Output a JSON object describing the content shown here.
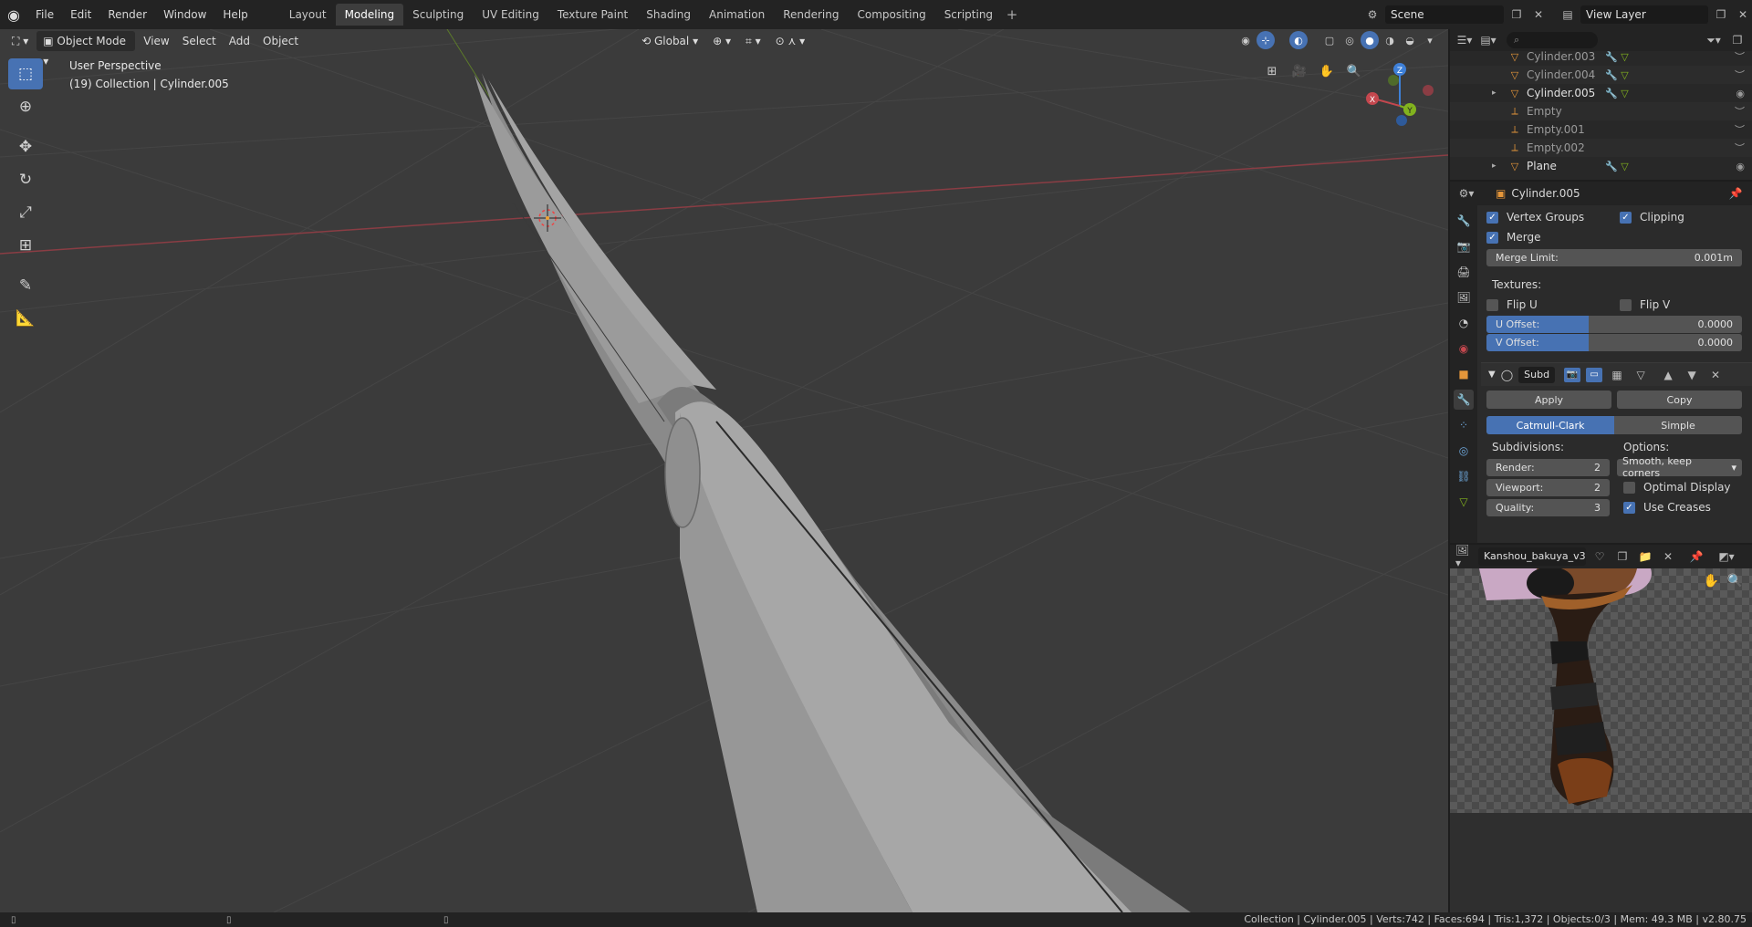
{
  "menus": [
    "File",
    "Edit",
    "Render",
    "Window",
    "Help"
  ],
  "workspaces": [
    "Layout",
    "Modeling",
    "Sculpting",
    "UV Editing",
    "Texture Paint",
    "Shading",
    "Animation",
    "Rendering",
    "Compositing",
    "Scripting"
  ],
  "active_workspace": "Modeling",
  "add_workspace": "+",
  "scene": "Scene",
  "view_layer": "View Layer",
  "viewport": {
    "mode": "Object Mode",
    "menus": [
      "View",
      "Select",
      "Add",
      "Object"
    ],
    "transform_orientation": "Global",
    "perspective": "User Perspective",
    "collection_info": "(19) Collection | Cylinder.005",
    "gizmo": {
      "x": "X",
      "y": "Y",
      "z": "Z"
    }
  },
  "outliner": {
    "items": [
      {
        "name": "Cylinder.003",
        "icon": "mesh",
        "has_modifiers": true,
        "visible": false,
        "expander": "",
        "bright": false
      },
      {
        "name": "Cylinder.004",
        "icon": "mesh",
        "has_modifiers": true,
        "visible": false,
        "expander": "",
        "bright": false
      },
      {
        "name": "Cylinder.005",
        "icon": "mesh",
        "has_modifiers": true,
        "visible": true,
        "expander": "▸",
        "bright": true
      },
      {
        "name": "Empty",
        "icon": "empty",
        "has_modifiers": false,
        "visible": false,
        "expander": "",
        "bright": false
      },
      {
        "name": "Empty.001",
        "icon": "empty",
        "has_modifiers": false,
        "visible": false,
        "expander": "",
        "bright": false
      },
      {
        "name": "Empty.002",
        "icon": "empty",
        "has_modifiers": false,
        "visible": false,
        "expander": "",
        "bright": false
      },
      {
        "name": "Plane",
        "icon": "mesh",
        "has_modifiers": true,
        "visible": true,
        "expander": "▸",
        "bright": true
      }
    ]
  },
  "properties": {
    "object_name": "Cylinder.005",
    "vertex_groups": "Vertex Groups",
    "clipping": "Clipping",
    "merge": "Merge",
    "merge_limit_label": "Merge Limit:",
    "merge_limit_value": "0.001m",
    "textures_label": "Textures:",
    "flip_u": "Flip U",
    "flip_v": "Flip V",
    "u_offset_label": "U Offset:",
    "u_offset_value": "0.0000",
    "v_offset_label": "V Offset:",
    "v_offset_value": "0.0000",
    "subsurf": {
      "name": "Subd",
      "apply": "Apply",
      "copy": "Copy",
      "catmull": "Catmull-Clark",
      "simple": "Simple",
      "subdivisions_label": "Subdivisions:",
      "options_label": "Options:",
      "render_label": "Render:",
      "render_value": "2",
      "viewport_label": "Viewport:",
      "viewport_value": "2",
      "quality_label": "Quality:",
      "quality_value": "3",
      "uv_smooth": "Smooth, keep corners",
      "optimal_display": "Optimal Display",
      "use_creases": "Use Creases"
    }
  },
  "image_editor": {
    "image_name": "Kanshou_bakuya_v3..."
  },
  "statusbar": {
    "text": "Collection | Cylinder.005 | Verts:742 | Faces:694 | Tris:1,372 | Objects:0/3 | Mem: 49.3 MB | v2.80.75"
  },
  "colors": {
    "accent": "#4772b3",
    "viewport_bg": "#3b3b3b",
    "x_axis": "#c4474e",
    "y_axis": "#82b31e",
    "z_axis": "#3e80d8"
  }
}
